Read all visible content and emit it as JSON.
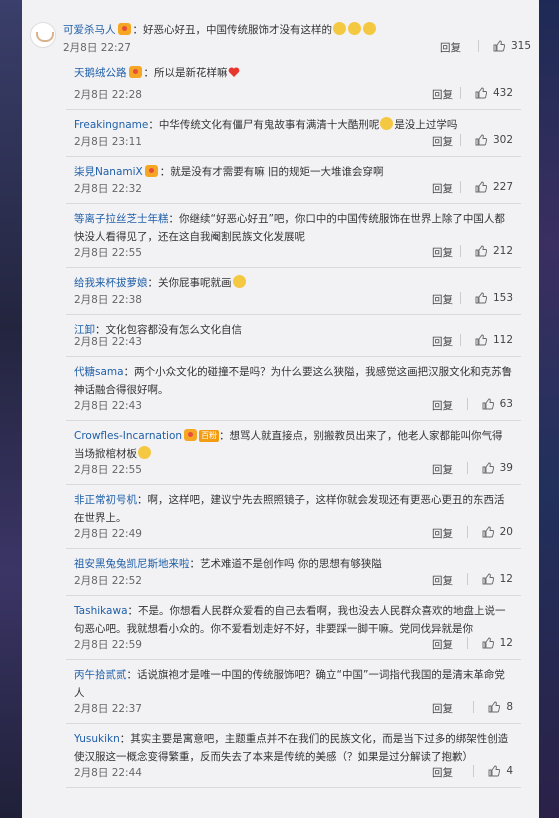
{
  "top_comment": {
    "user": "可爱杀马人",
    "text": "：好恶心好丑，中国传统服饰才没有这样的",
    "time": "2月8日 22:27",
    "reply_label": "回复",
    "likes": "315"
  },
  "replies": [
    {
      "user": "天鹅绒公路",
      "text": "：所以是新花样嘛",
      "time": "2月8日 22:28",
      "reply_label": "回复",
      "likes": "432",
      "badge": true,
      "heart": true
    },
    {
      "user": "Freakingname",
      "text": "：中华传统文化有僵尸有鬼故事有满清十大酷刑呢",
      "text2": "是没上过学吗",
      "time": "2月8日 23:11",
      "reply_label": "回复",
      "likes": "302",
      "emoji_mid": true
    },
    {
      "user": "柒見NanamiX",
      "text": "：就是没有才需要有嘛 旧的规矩一大堆谁会穿啊",
      "time": "2月8日 22:32",
      "reply_label": "回复",
      "likes": "227",
      "badge": true
    },
    {
      "user": "等离子拉丝芝士年糕",
      "text": "：你继续“好恶心好丑”吧，你口中的中国传统服饰在世界上除了中国人都快没人看得见了，还在这自我阉割民族文化发展呢",
      "time": "2月8日 22:55",
      "reply_label": "回复",
      "likes": "212"
    },
    {
      "user": "给我来杯拔萝娘",
      "text": "：关你屁事呢就画",
      "time": "2月8日 22:38",
      "reply_label": "回复",
      "likes": "153",
      "emoji_end": true
    },
    {
      "user": "江卸",
      "text": "：文化包容都没有怎么文化自信",
      "time": "2月8日 22:43",
      "reply_label": "回复",
      "likes": "112"
    },
    {
      "user": "代糖sama",
      "text": "：两个小众文化的碰撞不是吗？为什么要这么狭隘，我感觉这画把汉服文化和克苏鲁神话融合得很好啊。",
      "time": "2月8日 22:43",
      "reply_label": "回复",
      "likes": "63"
    },
    {
      "user": "Crowfles-Incarnation",
      "text": "：想骂人就直接点，别搬教员出来了，他老人家都能叫你气得当场掀棺材板",
      "time": "2月8日 22:55",
      "reply_label": "回复",
      "likes": "39",
      "badge": true,
      "vip": "百粉",
      "emoji_end": true
    },
    {
      "user": "非正常初号机",
      "text": "：啊，这样吧，建议宁先去照照镜子，这样你就会发现还有更恶心更丑的东西活在世界上。",
      "time": "2月8日 22:49",
      "reply_label": "回复",
      "likes": "20"
    },
    {
      "user": "祖安黑兔兔凯尼斯地来啦",
      "text": "：艺术难道不是创作吗 你的思想有够狭隘",
      "time": "2月8日 22:52",
      "reply_label": "回复",
      "likes": "12"
    },
    {
      "user": "Tashikawa",
      "text": "：不是。你想看人民群众爱看的自己去看啊，我也没去人民群众喜欢的地盘上说一句恶心吧。我就想看小众的。你不爱看划走好不好，非要踩一脚干嘛。党同伐异就是你",
      "time": "2月8日 22:59",
      "reply_label": "回复",
      "likes": "12"
    },
    {
      "user": "丙午拾贰贰",
      "text": "：话说旗袍才是唯一中国的传统服饰吧？确立“中国”一词指代我国的是清末革命党人",
      "time": "2月8日 22:37",
      "reply_label": "回复",
      "likes": "8"
    },
    {
      "user": "Yusukikn",
      "text": "：其实主要是寓意吧，主题重点并不在我们的民族文化，而是当下过多的绑架性创造使汉服这一概念变得繁重，反而失去了本来是传统的美感（？如果是过分解读了抱歉）",
      "time": "2月8日 22:44",
      "reply_label": "回复",
      "likes": "4"
    }
  ]
}
